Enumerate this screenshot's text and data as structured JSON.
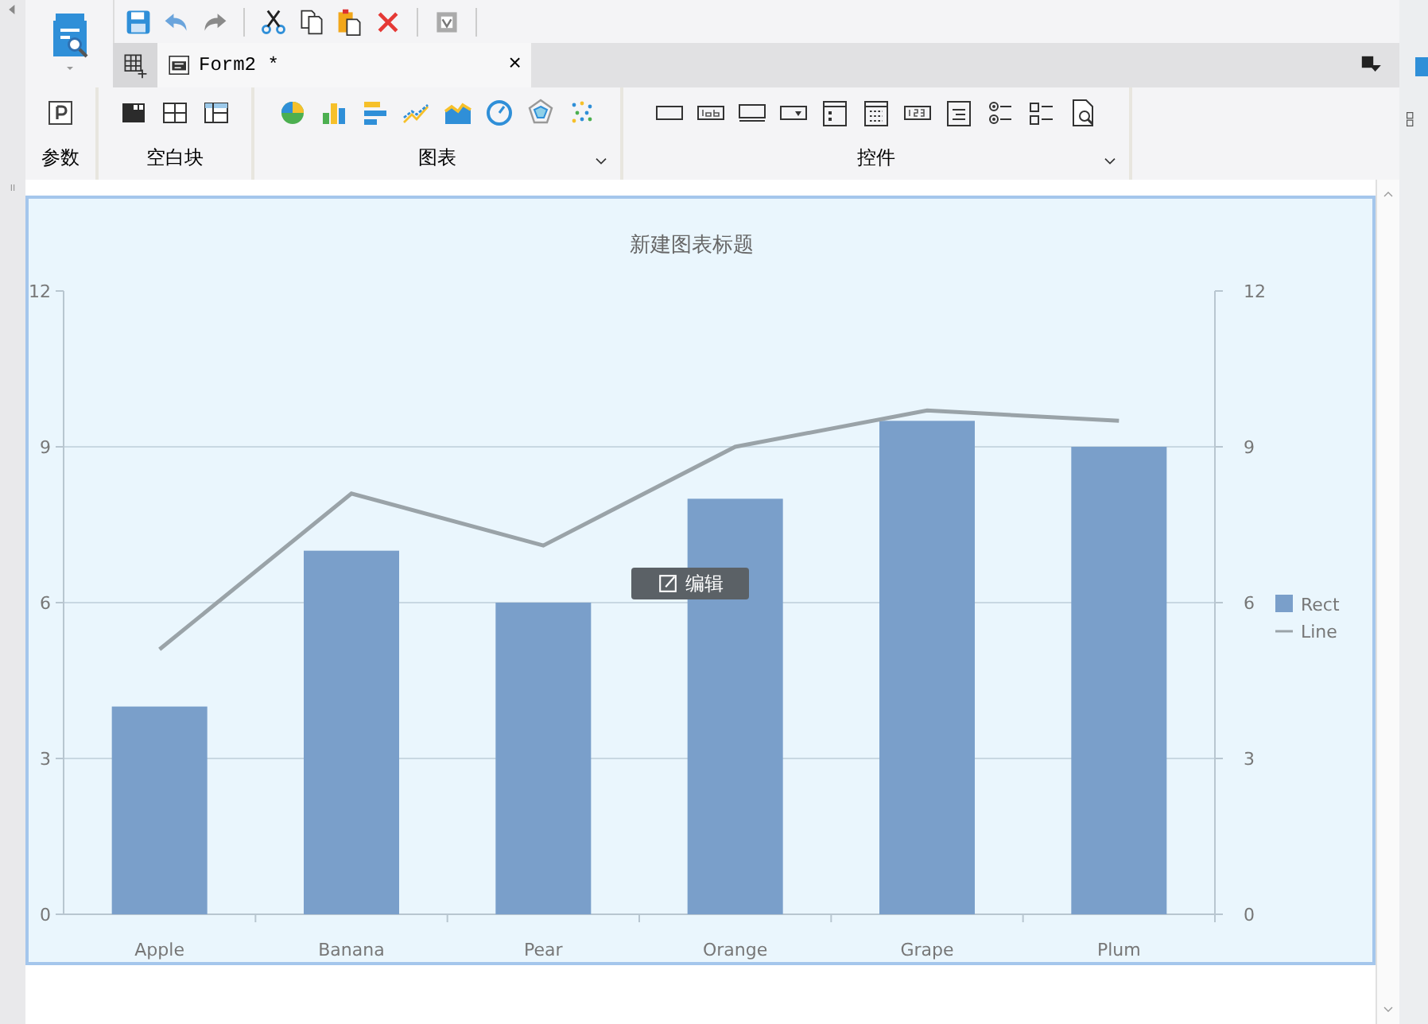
{
  "tabs": [
    {
      "label": "Form2 *",
      "selected": true,
      "close": "×"
    }
  ],
  "ribbon": {
    "groups": [
      {
        "label": "参数",
        "expandable": false
      },
      {
        "label": "空白块",
        "expandable": false
      },
      {
        "label": "图表",
        "expandable": true
      },
      {
        "label": "控件",
        "expandable": true
      }
    ]
  },
  "chart": {
    "edit_button": "编辑",
    "chart_data": {
      "type": "bar",
      "title": "新建图表标题",
      "categories": [
        "Apple",
        "Banana",
        "Pear",
        "Orange",
        "Grape",
        "Plum"
      ],
      "series": [
        {
          "name": "Rect",
          "type": "bar",
          "color": "#7a9fca",
          "values": [
            4,
            7,
            6,
            8,
            9.5,
            9
          ]
        },
        {
          "name": "Line",
          "type": "line",
          "color": "#9aa3a8",
          "values": [
            5.1,
            8.1,
            7.1,
            9,
            9.7,
            9.5
          ]
        }
      ],
      "ylim": [
        0,
        12
      ],
      "yticks": [
        0,
        3,
        6,
        9,
        12
      ],
      "grid": true,
      "legend": "right"
    },
    "right_axis_ticks": [
      "12",
      "9",
      "6",
      "3",
      "0"
    ]
  }
}
